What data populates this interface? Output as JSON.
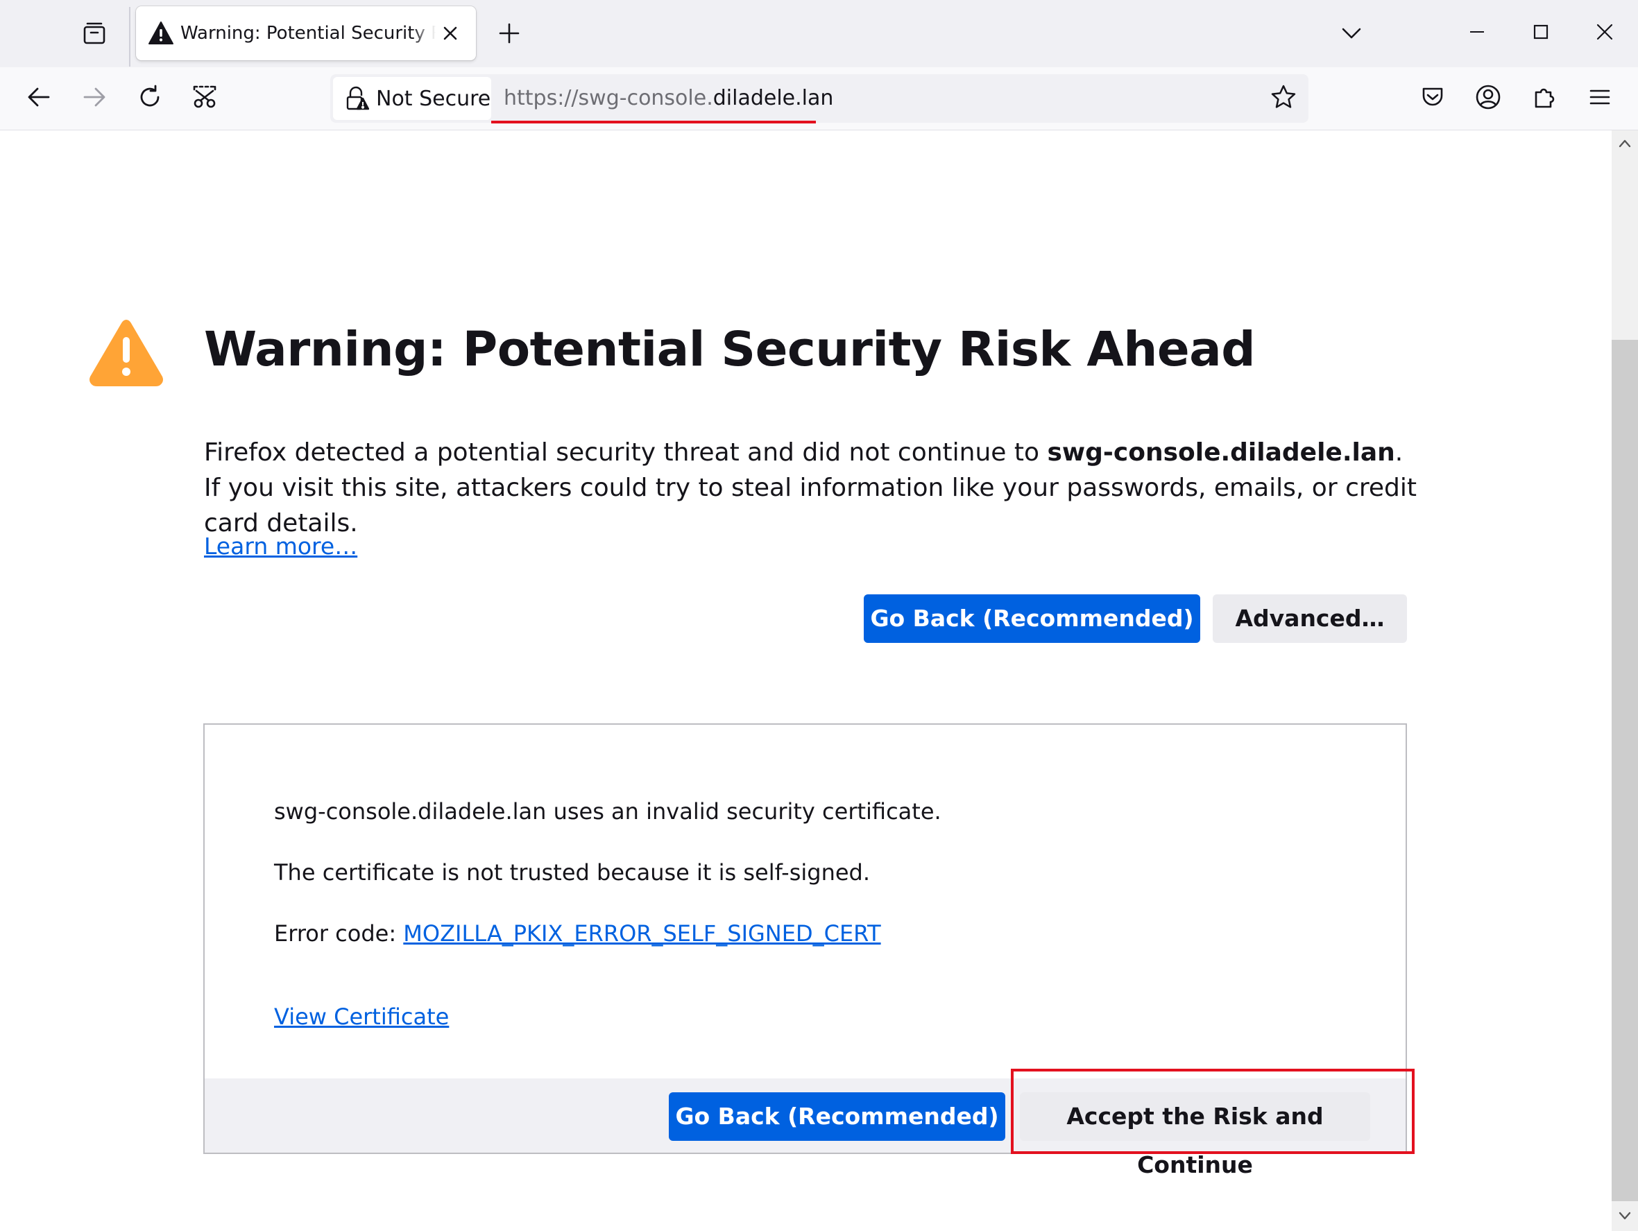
{
  "colors": {
    "accent": "#0061e0",
    "warning": "#ffa436",
    "highlight": "#e3111f"
  },
  "tabstrip": {
    "tab": {
      "title": "Warning: Potential Security Risk Ahead",
      "icon": "warning-icon"
    },
    "icons": [
      "tab-list-icon",
      "close-icon",
      "plus-icon",
      "chevron-down-icon",
      "minimize-icon",
      "maximize-icon",
      "close-icon"
    ]
  },
  "toolbar": {
    "icons": [
      "back-arrow-icon",
      "forward-arrow-icon",
      "reload-icon",
      "screenshot-icon",
      "pocket-icon",
      "account-icon",
      "extensions-icon",
      "menu-icon"
    ],
    "identity_label": "Not Secure",
    "url_prefix": "https://swg-console.",
    "url_domain": "diladele.lan"
  },
  "page": {
    "title": "Warning: Potential Security Risk Ahead",
    "intro_before": "Firefox detected a potential security threat and did not continue to ",
    "intro_host": "swg-console.diladele.lan",
    "intro_after": ". If you visit this site, attackers could try to steal information like your passwords, emails, or credit card details.",
    "learn_more": "Learn more…",
    "go_back": "Go Back (Recommended)",
    "advanced": "Advanced…"
  },
  "details": {
    "line1": "swg-console.diladele.lan uses an invalid security certificate.",
    "line2": "The certificate is not trusted because it is self-signed.",
    "error_code_label": "Error code: ",
    "error_code": "MOZILLA_PKIX_ERROR_SELF_SIGNED_CERT",
    "view_certificate": "View Certificate",
    "go_back": "Go Back (Recommended)",
    "accept": "Accept the Risk and Continue"
  }
}
